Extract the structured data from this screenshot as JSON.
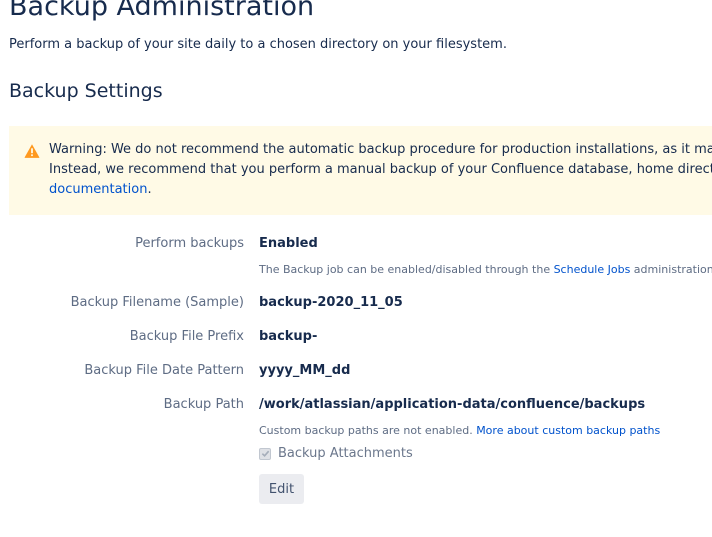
{
  "page": {
    "title": "Backup Administration",
    "description": "Perform a backup of your site daily to a chosen directory on your filesystem."
  },
  "section": {
    "title": "Backup Settings"
  },
  "warning": {
    "icon": "warning-icon",
    "color": "#ff991f",
    "line1": "Warning: We do not recommend the automatic backup procedure for production installations, as it may req",
    "line2": "Instead, we recommend that you perform a manual backup of your Confluence database, home directory ar",
    "link": "documentation",
    "link_suffix": "."
  },
  "settings": {
    "perform_backups": {
      "label": "Perform backups",
      "value": "Enabled",
      "desc_prefix": "The Backup job can be enabled/disabled through the ",
      "desc_link": "Schedule Jobs",
      "desc_suffix": " administration pa"
    },
    "filename": {
      "label": "Backup Filename (Sample)",
      "value": "backup-2020_11_05"
    },
    "prefix": {
      "label": "Backup File Prefix",
      "value": "backup-"
    },
    "date_pattern": {
      "label": "Backup File Date Pattern",
      "value": "yyyy_MM_dd"
    },
    "path": {
      "label": "Backup Path",
      "value": "/work/atlassian/application-data/confluence/backups",
      "desc_prefix": "Custom backup paths are not enabled. ",
      "desc_link": "More about custom backup paths"
    },
    "attachments": {
      "label": "Backup Attachments",
      "checked": true
    }
  },
  "buttons": {
    "edit": "Edit"
  },
  "colors": {
    "link": "#0052cc",
    "warning_bg": "#fffae6",
    "text": "#172b4d"
  }
}
